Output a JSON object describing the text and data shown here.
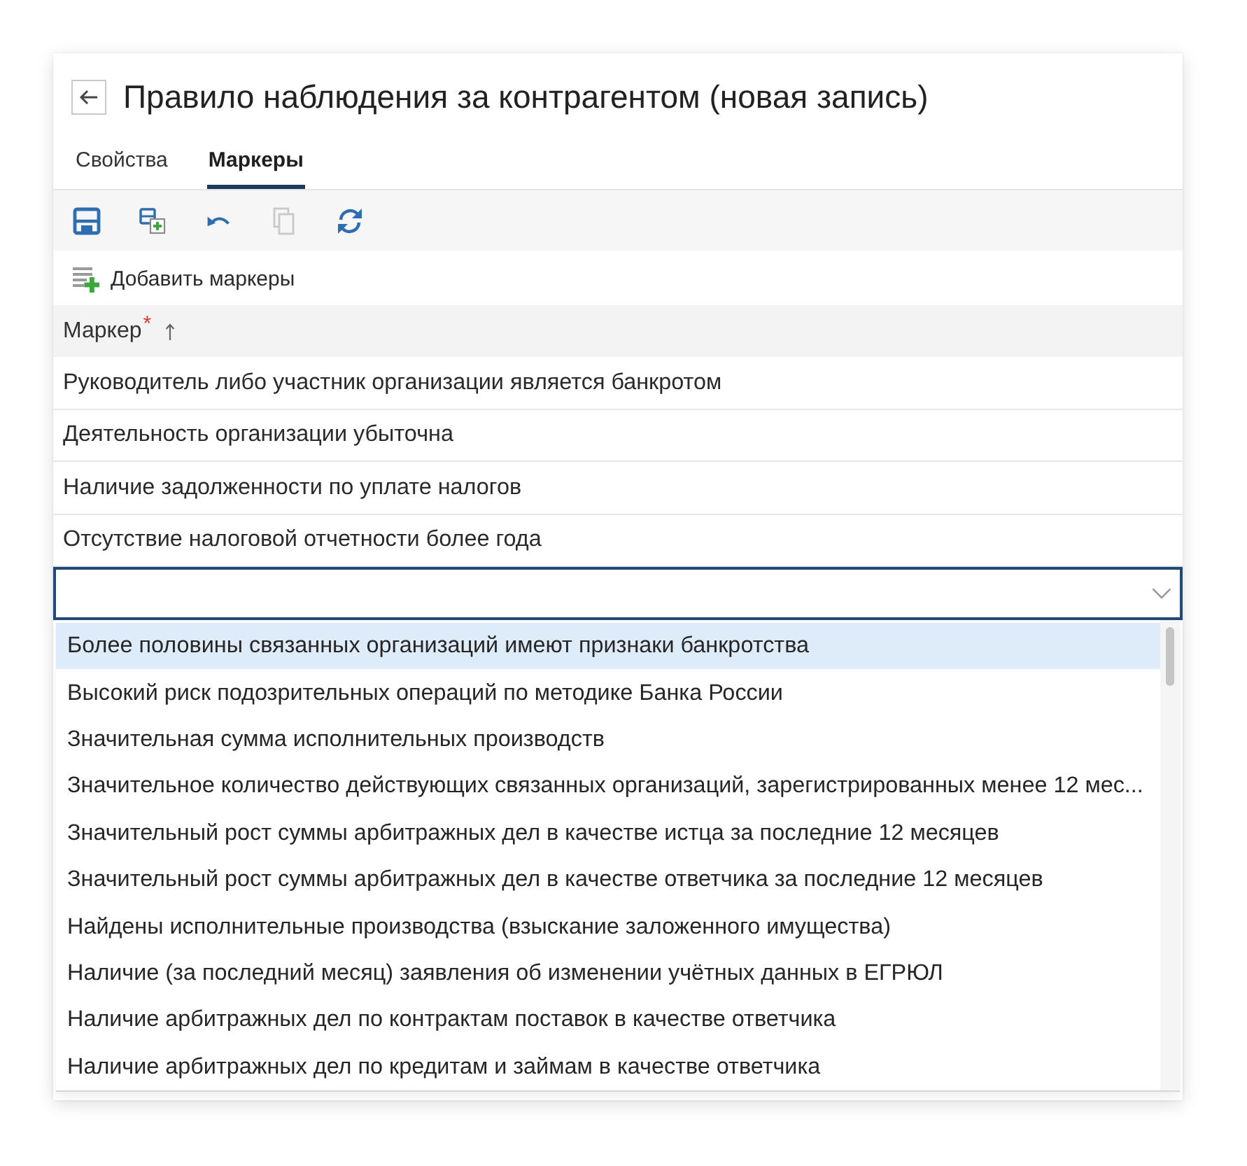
{
  "header": {
    "title": "Правило наблюдения за контрагентом (новая запись)"
  },
  "tabs": [
    {
      "label": "Свойства",
      "selected": false
    },
    {
      "label": "Маркеры",
      "selected": true
    }
  ],
  "toolbar": {
    "buttons": [
      {
        "kind": "save",
        "disabled": false
      },
      {
        "kind": "save_new",
        "disabled": false
      },
      {
        "kind": "undo",
        "disabled": false
      },
      {
        "kind": "copy",
        "disabled": true
      },
      {
        "kind": "refresh",
        "disabled": false
      }
    ]
  },
  "add_button": {
    "label": "Добавить маркеры"
  },
  "table": {
    "columns": [
      {
        "label": "Маркер",
        "required_mark": "*",
        "sorted_ascending": true
      }
    ],
    "rows": [
      {
        "marker": "Руководитель либо участник организации является банкротом"
      },
      {
        "marker": "Деятельность организации убыточна"
      },
      {
        "marker": "Наличие задолженности по уплате налогов"
      },
      {
        "marker": "Отсутствие налоговой отчетности более года"
      }
    ]
  },
  "combo": {
    "focused": true,
    "expanded": true,
    "options": [
      {
        "label": "Более половины связанных организаций имеют признаки банкротства",
        "selected": true
      },
      {
        "label": "Высокий риск подозрительных операций по методике Банка России",
        "selected": false
      },
      {
        "label": "Значительная сумма исполнительных производств",
        "selected": false
      },
      {
        "label": "Значительное количество действующих связанных организаций, зарегистрированных менее 12 мес...",
        "selected": false
      },
      {
        "label": "Значительный рост суммы арбитражных дел в качестве истца за последние 12 месяцев",
        "selected": false
      },
      {
        "label": "Значительный рост суммы арбитражных дел в качестве ответчика за последние 12 месяцев",
        "selected": false
      },
      {
        "label": "Найдены исполнительные производства (взыскание заложенного имущества)",
        "selected": false
      },
      {
        "label": "Наличие (за последний месяц) заявления об изменении учётных данных в ЕГРЮЛ",
        "selected": false
      },
      {
        "label": "Наличие арбитражных дел по контрактам поставок в качестве ответчика",
        "selected": false
      },
      {
        "label": "Наличие арбитражных дел по кредитам и займам в качестве ответчика",
        "selected": false
      }
    ]
  }
}
